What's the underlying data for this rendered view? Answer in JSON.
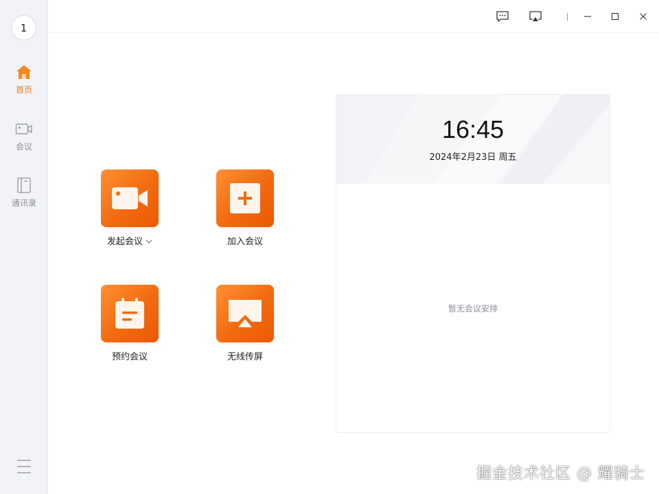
{
  "user": {
    "avatar_text": "1"
  },
  "sidebar": {
    "items": [
      {
        "label": "首页",
        "icon": "home-icon",
        "active": true
      },
      {
        "label": "会议",
        "icon": "video-camera-icon",
        "active": false
      },
      {
        "label": "通讯录",
        "icon": "contacts-book-icon",
        "active": false
      }
    ],
    "menu_icon": "hamburger-menu-icon"
  },
  "titlebar": {
    "buttons": [
      "feedback-icon",
      "screen-cast-icon",
      "minimize-icon",
      "maximize-icon",
      "close-icon"
    ]
  },
  "actions": {
    "start_meeting": "发起会议",
    "join_meeting": "加入会议",
    "schedule_meeting": "预约会议",
    "wireless_share": "无线传屏"
  },
  "schedule": {
    "time": "16:45",
    "date": "2024年2月23日 周五",
    "empty_text": "暂无会议安排"
  },
  "watermark": "掘金技术社区 @ 耀骑士",
  "colors": {
    "accent": "#f07b1d",
    "tile_gradient_start": "#ff8f33",
    "tile_gradient_end": "#ea5a05"
  }
}
